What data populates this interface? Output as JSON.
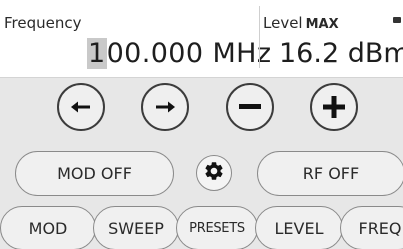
{
  "display": {
    "frequency_label": "Frequency",
    "frequency_cursor_digit": "1",
    "frequency_rest": "00.000 MHz",
    "level_label": "Level",
    "level_mode": "MAX",
    "level_value": "16.2 dBm"
  },
  "step_buttons": [
    {
      "icon": "arrow-left-icon"
    },
    {
      "icon": "arrow-right-icon"
    },
    {
      "icon": "minus-icon"
    },
    {
      "icon": "plus-icon"
    }
  ],
  "toggles": {
    "mod_label": "MOD OFF",
    "rf_label": "RF OFF",
    "settings_icon": "gear-icon"
  },
  "tabs": [
    "MOD",
    "SWEEP",
    "PRESETS",
    "LEVEL",
    "FREQ"
  ],
  "colors": {
    "display_bg": "#ffffff",
    "panel_bg": "#e7e7e7",
    "button_bg": "#f0f0f0",
    "outline": "#3c3c3c"
  }
}
